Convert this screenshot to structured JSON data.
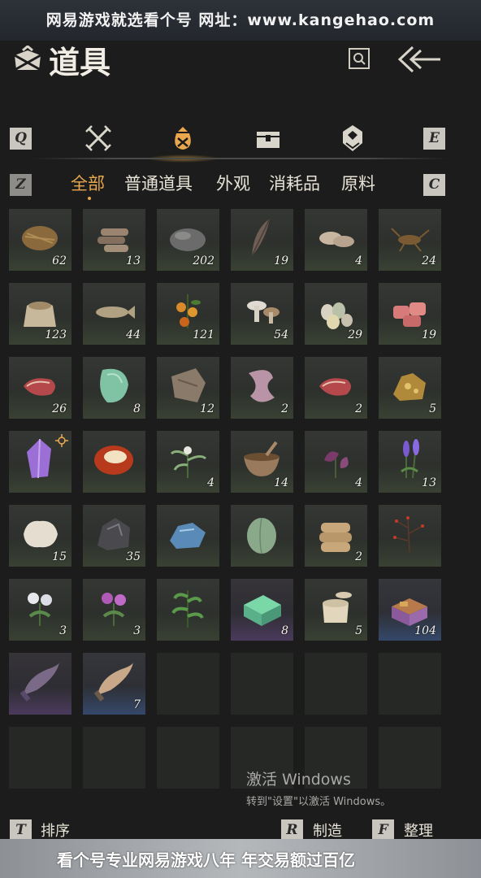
{
  "banner": {
    "top_text": "网易游戏就选看个号  网址：www.kangehao.com",
    "bottom_text": "看个号专业网易游戏八年 年交易额过百亿"
  },
  "header": {
    "title": "道具",
    "title_icon": "bundle-icon",
    "search_icon": "search-icon",
    "back_icon": "back-arrow-icon"
  },
  "category_tabs": {
    "prev_key": "Q",
    "next_key": "E",
    "tabs": [
      {
        "icon": "crossed-swords-icon",
        "active": false
      },
      {
        "icon": "pouch-icon",
        "active": true
      },
      {
        "icon": "chest-icon",
        "active": false
      },
      {
        "icon": "gem-badge-icon",
        "active": false
      }
    ]
  },
  "sub_tabs": {
    "prev_key": "Z",
    "next_key": "C",
    "tabs": [
      "全部",
      "普通道具",
      "外观",
      "消耗品",
      "原料"
    ],
    "active_index": 0
  },
  "items": [
    {
      "name": "hay-bundle",
      "count": "62"
    },
    {
      "name": "wood-logs",
      "count": "13"
    },
    {
      "name": "stone",
      "count": "202"
    },
    {
      "name": "feather",
      "count": "19"
    },
    {
      "name": "mushroom-slices",
      "count": "4"
    },
    {
      "name": "cricket",
      "count": "24"
    },
    {
      "name": "grain-sack",
      "count": "123"
    },
    {
      "name": "fish",
      "count": "44"
    },
    {
      "name": "berries",
      "count": "121"
    },
    {
      "name": "mushrooms",
      "count": "54"
    },
    {
      "name": "eggs",
      "count": "29"
    },
    {
      "name": "raw-meat-chunks",
      "count": "19"
    },
    {
      "name": "steak",
      "count": "26"
    },
    {
      "name": "jade-stone",
      "count": "8"
    },
    {
      "name": "leather-hide",
      "count": "12"
    },
    {
      "name": "silk-cloth",
      "count": "2"
    },
    {
      "name": "steak-2",
      "count": "2"
    },
    {
      "name": "gold-ore",
      "count": "5"
    },
    {
      "name": "amethyst-crystal",
      "count": "",
      "tracked": true
    },
    {
      "name": "red-agate",
      "count": ""
    },
    {
      "name": "white-herb",
      "count": "4"
    },
    {
      "name": "mortar-bowl",
      "count": "14"
    },
    {
      "name": "purple-flower",
      "count": "4"
    },
    {
      "name": "lavender",
      "count": "13"
    },
    {
      "name": "white-fur",
      "count": "15"
    },
    {
      "name": "dark-ore",
      "count": "35"
    },
    {
      "name": "blue-ore",
      "count": ""
    },
    {
      "name": "green-melon",
      "count": ""
    },
    {
      "name": "flour-bags",
      "count": "2"
    },
    {
      "name": "red-berry-branch",
      "count": ""
    },
    {
      "name": "white-chrysanthemum",
      "count": "3"
    },
    {
      "name": "purple-chrysanthemum",
      "count": "3"
    },
    {
      "name": "green-herb",
      "count": ""
    },
    {
      "name": "jade-box",
      "count": "8",
      "rarity": "rare"
    },
    {
      "name": "porcelain-jar",
      "count": "5"
    },
    {
      "name": "gift-box",
      "count": "104",
      "rarity": "blue"
    },
    {
      "name": "horn-purple",
      "count": "",
      "rarity": "rare"
    },
    {
      "name": "horn-blue",
      "count": "7",
      "rarity": "blue"
    }
  ],
  "empty_slots": 10,
  "windows_watermark": {
    "line1": "激活 Windows",
    "line2": "转到\"设置\"以激活 Windows。"
  },
  "bottom_bar": {
    "sort": {
      "key": "T",
      "label": "排序"
    },
    "craft": {
      "key": "R",
      "label": "制造"
    },
    "organize": {
      "key": "F",
      "label": "整理"
    }
  },
  "colors": {
    "accent": "#e9a84e",
    "background": "#1b1c1b",
    "key_bg": "#c9c6bf"
  }
}
